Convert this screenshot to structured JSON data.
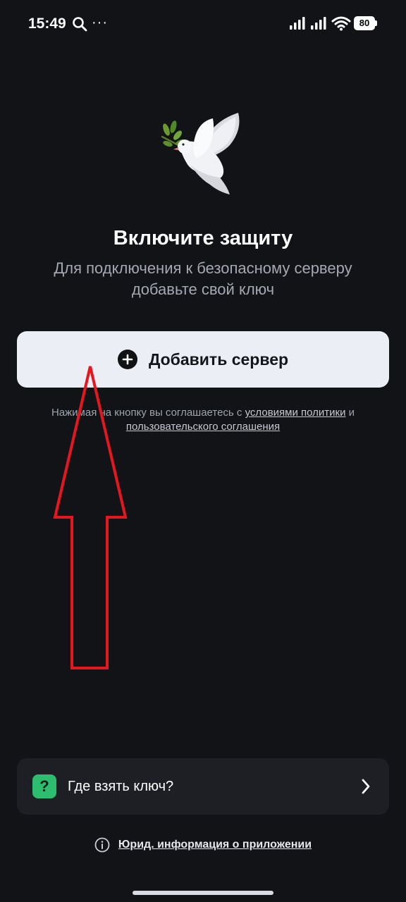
{
  "status_bar": {
    "time": "15:49",
    "dots": "···",
    "battery": "80",
    "icons": [
      "search-icon",
      "signal-icon",
      "signal-icon",
      "wifi-icon",
      "battery-icon"
    ]
  },
  "onboarding": {
    "illustration": "dove-with-olive-branch",
    "title": "Включите защиту",
    "subtitle": "Для подключения к безопасному серверу добавьте свой ключ",
    "add_button_label": "Добавить сервер",
    "consent_prefix": "Нажимая на кнопку вы соглашаетесь с ",
    "consent_link_1": "условиями политики",
    "consent_middle": " и ",
    "consent_link_2": "пользовательского соглашения"
  },
  "annotation": {
    "type": "arrow-up",
    "color": "#e5161d"
  },
  "help_card": {
    "icon_glyph": "?",
    "label": "Где взять ключ?",
    "icon_color": "#2dbd6e"
  },
  "footer": {
    "legal_link": "Юрид. информация о приложении"
  },
  "colors": {
    "background": "#121316",
    "button_bg": "#eceef5",
    "card_bg": "#1d1f24",
    "subtitle": "#a4a8b2"
  }
}
